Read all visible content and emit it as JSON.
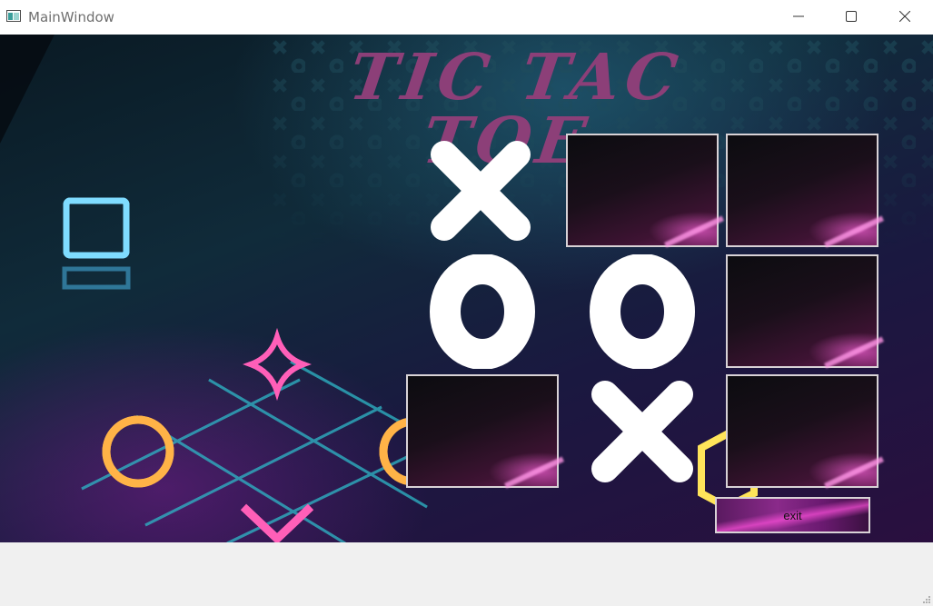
{
  "window": {
    "title": "MainWindow"
  },
  "game": {
    "title": "TIC TAC TOE",
    "board": [
      [
        "X",
        "",
        ""
      ],
      [
        "O",
        "O",
        ""
      ],
      [
        "",
        "X",
        ""
      ]
    ],
    "exit_label": "exit"
  },
  "icons": {
    "minimize": "minimize-icon",
    "maximize": "maximize-icon",
    "close": "close-icon",
    "app": "app-icon"
  },
  "colors": {
    "title": "#8c3f78",
    "mark": "#ffffff",
    "neon_blue": "#7fdcff",
    "neon_pink": "#ff5fb8",
    "neon_orange": "#ffb347",
    "neon_yellow": "#ffe45a"
  }
}
